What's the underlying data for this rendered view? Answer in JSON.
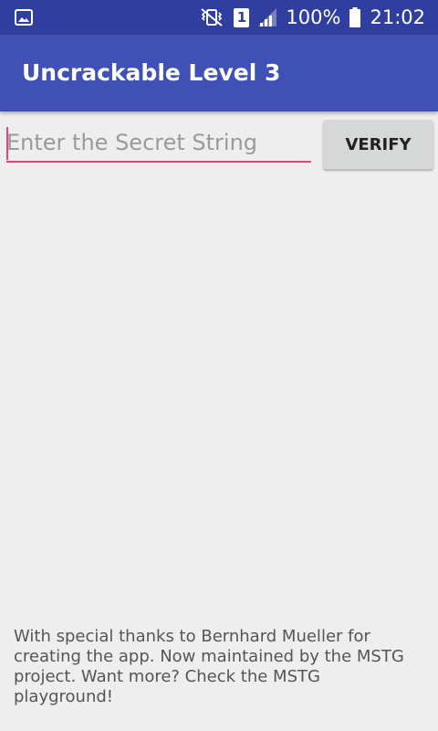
{
  "status_bar": {
    "battery_percent": "100%",
    "time": "21:02",
    "sim_slot": "1",
    "icons": [
      "gallery-icon",
      "vibrate-mute-icon",
      "sim-icon",
      "signal-icon",
      "battery-icon"
    ]
  },
  "app_bar": {
    "title": "Uncrackable Level 3"
  },
  "form": {
    "input_placeholder": "Enter the Secret String",
    "input_value": "",
    "verify_label": "VERIFY"
  },
  "footer": {
    "text": "With special thanks to Bernhard Mueller for creating the app. Now maintained by the MSTG project. Want more? Check the MSTG playground!"
  },
  "colors": {
    "status_bar": "#303f9f",
    "app_bar": "#3f51b5",
    "accent": "#e8437d",
    "background": "#eeeeee",
    "button": "#d6d7d7"
  }
}
